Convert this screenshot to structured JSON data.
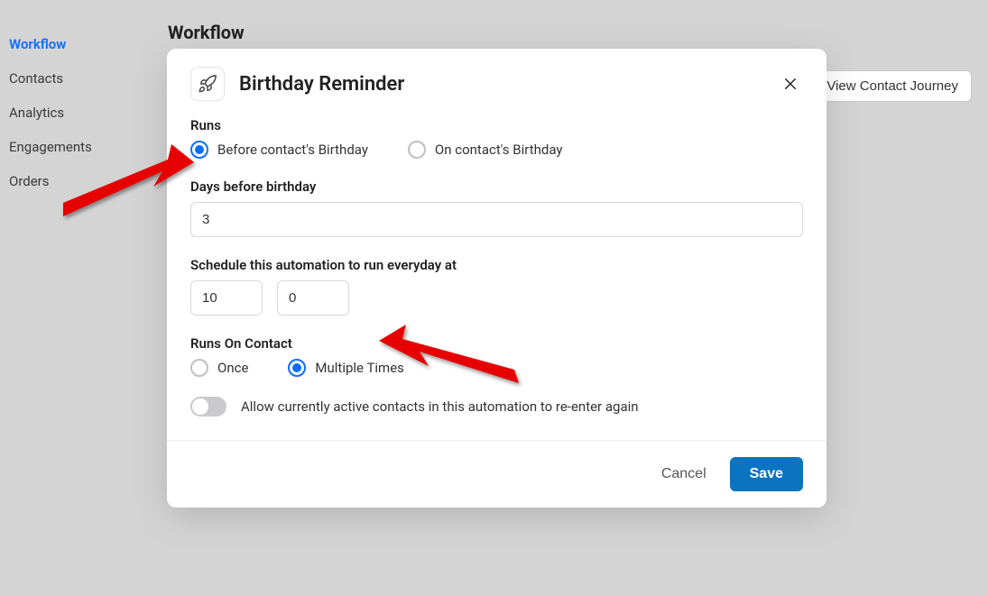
{
  "sidebar": {
    "items": [
      {
        "label": "Workflow",
        "active": true
      },
      {
        "label": "Contacts",
        "active": false
      },
      {
        "label": "Analytics",
        "active": false
      },
      {
        "label": "Engagements",
        "active": false
      },
      {
        "label": "Orders",
        "active": false
      }
    ]
  },
  "main": {
    "title": "Workflow",
    "view_journey_label": "View Contact Journey"
  },
  "modal": {
    "title": "Birthday Reminder",
    "runs_label": "Runs",
    "runs_options": {
      "before": "Before contact's Birthday",
      "on": "On contact's Birthday"
    },
    "runs_selected": "before",
    "days_before_label": "Days before birthday",
    "days_before_value": "3",
    "schedule_label": "Schedule this automation to run everyday at",
    "schedule_hour": "10",
    "schedule_minute": "0",
    "runs_on_contact_label": "Runs On Contact",
    "runs_on_contact_options": {
      "once": "Once",
      "multiple": "Multiple Times"
    },
    "runs_on_contact_selected": "multiple",
    "reenter_toggle_label": "Allow currently active contacts in this automation to re-enter again",
    "reenter_toggle_on": false,
    "cancel_label": "Cancel",
    "save_label": "Save"
  }
}
